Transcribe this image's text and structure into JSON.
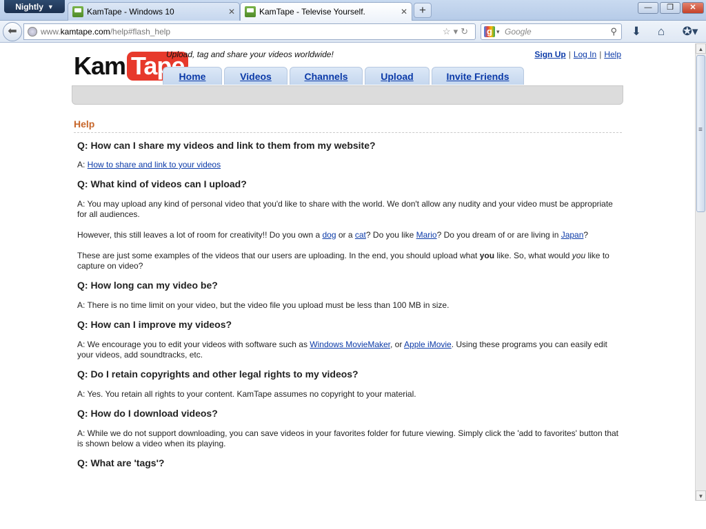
{
  "browser": {
    "app_menu": "Nightly",
    "tabs": [
      {
        "title": "KamTape - Windows 10"
      },
      {
        "title": "KamTape - Televise Yourself."
      }
    ],
    "new_tab": "+",
    "url_prefix": "www.",
    "url_domain": "kamtape.com",
    "url_path": "/help#flash_help",
    "search_placeholder": "Google",
    "window_controls": {
      "minimize": "—",
      "restore": "❐",
      "close": "✕"
    }
  },
  "site": {
    "logo": {
      "part1": "Kam",
      "part2": "Tape"
    },
    "tagline": "Upload, tag and share your videos worldwide!",
    "top_links": {
      "signup": "Sign Up",
      "login": "Log In",
      "help": "Help",
      "separator": "|"
    },
    "nav": [
      {
        "label": "Home"
      },
      {
        "label": "Videos"
      },
      {
        "label": "Channels"
      },
      {
        "label": "Upload"
      },
      {
        "label": "Invite Friends"
      }
    ]
  },
  "help": {
    "heading": "Help",
    "faq": {
      "q1": "Q: How can I share my videos and link to them from my website?",
      "a1_prefix": "A: ",
      "a1_link": "How to share and link to your videos",
      "q2": "Q: What kind of videos can I upload?",
      "a2_p1": "A: You may upload any kind of personal video that you'd like to share with the world. We don't allow any nudity and your video must be appropriate for all audiences.",
      "a2_p2_t1": "However, this still leaves a lot of room for creativity!! Do you own a ",
      "a2_p2_dog": "dog",
      "a2_p2_t2": " or a ",
      "a2_p2_cat": "cat",
      "a2_p2_t3": "? Do you like ",
      "a2_p2_mario": "Mario",
      "a2_p2_t4": "? Do you dream of or are living in ",
      "a2_p2_japan": "Japan",
      "a2_p2_t5": "?",
      "a2_p3_t1": "These are just some examples of the videos that our users are uploading. In the end, you should upload what ",
      "a2_p3_you_bold": "you",
      "a2_p3_t2": " like. So, what would ",
      "a2_p3_you_italic": "you",
      "a2_p3_t3": " like to capture on video?",
      "q3": "Q: How long can my video be?",
      "a3": "A: There is no time limit on your video, but the video file you upload must be less than 100 MB in size.",
      "q4": "Q: How can I improve my videos?",
      "a4_t1": "A: We encourage you to edit your videos with software such as ",
      "a4_link1": "Windows MovieMaker",
      "a4_t2": ", or ",
      "a4_link2": "Apple iMovie",
      "a4_t3": ". Using these programs you can easily edit your videos, add soundtracks, etc.",
      "q5": "Q: Do I retain copyrights and other legal rights to my videos?",
      "a5": "A: Yes. You retain all rights to your content. KamTape assumes no copyright to your material.",
      "q6": "Q: How do I download videos?",
      "a6": "A: While we do not support downloading, you can save videos in your favorites folder for future viewing. Simply click the 'add to favorites' button that is shown below a video when its playing.",
      "q7": "Q: What are 'tags'?"
    }
  }
}
